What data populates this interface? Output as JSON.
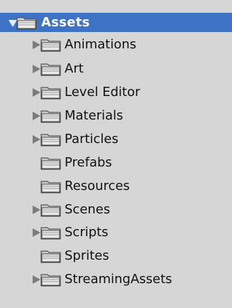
{
  "project_panel": {
    "root": {
      "label": "Assets",
      "icon": "folder-icon",
      "expanded": true,
      "selected": true
    },
    "children": [
      {
        "label": "Animations",
        "icon": "folder-icon",
        "has_children": true
      },
      {
        "label": "Art",
        "icon": "folder-icon",
        "has_children": true
      },
      {
        "label": "Level Editor",
        "icon": "folder-icon",
        "has_children": true
      },
      {
        "label": "Materials",
        "icon": "folder-icon",
        "has_children": true
      },
      {
        "label": "Particles",
        "icon": "folder-icon",
        "has_children": true
      },
      {
        "label": "Prefabs",
        "icon": "folder-icon",
        "has_children": false
      },
      {
        "label": "Resources",
        "icon": "folder-icon",
        "has_children": false
      },
      {
        "label": "Scenes",
        "icon": "folder-icon",
        "has_children": true
      },
      {
        "label": "Scripts",
        "icon": "folder-icon",
        "has_children": true
      },
      {
        "label": "Sprites",
        "icon": "folder-icon",
        "has_children": false
      },
      {
        "label": "StreamingAssets",
        "icon": "folder-icon",
        "has_children": true
      }
    ]
  },
  "colors": {
    "panel_background": "#d6d6d6",
    "selection": "#3d72c5",
    "foldout_arrow": "#7c7c7c",
    "text": "#111111",
    "selected_text": "#ffffff"
  }
}
